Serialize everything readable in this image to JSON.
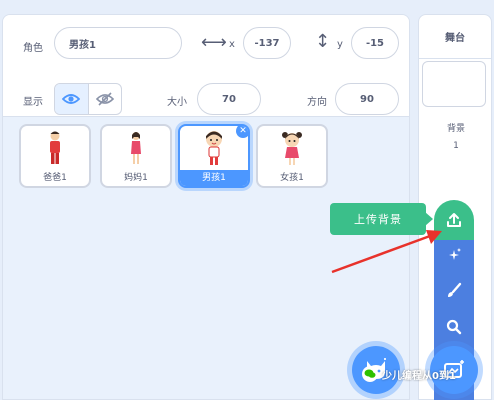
{
  "sprite_info": {
    "sprite_label": "角色",
    "sprite_name": "男孩1",
    "x_label": "x",
    "x_value": "-137",
    "y_label": "y",
    "y_value": "-15",
    "show_label": "显示",
    "size_label": "大小",
    "size_value": "70",
    "direction_label": "方向",
    "direction_value": "90"
  },
  "sprites": [
    {
      "name": "爸爸1",
      "selected": false
    },
    {
      "name": "妈妈1",
      "selected": false
    },
    {
      "name": "男孩1",
      "selected": true
    },
    {
      "name": "女孩1",
      "selected": false
    }
  ],
  "stage": {
    "title": "舞台",
    "backdrops_label": "背景",
    "backdrops_count": "1"
  },
  "backdrop_menu": {
    "tooltip": "上传背景",
    "items": [
      "upload-icon",
      "surprise-icon",
      "paint-icon",
      "search-icon"
    ]
  },
  "annotation": {
    "arrow_color": "#e8322b"
  },
  "colors": {
    "accent": "#4c97ff",
    "upload_green": "#3bbf8a",
    "menu_blue": "#4c7fe0"
  },
  "watermark": {
    "text": "少儿编程从0到1"
  }
}
